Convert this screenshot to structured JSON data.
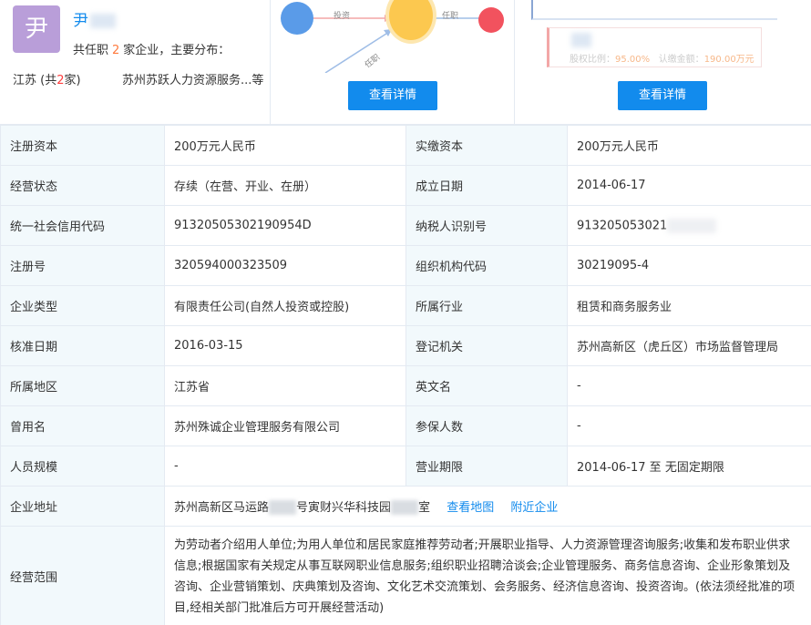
{
  "person": {
    "avatar_char": "尹",
    "name": "尹",
    "summary_prefix": "共任职",
    "company_count": "2",
    "summary_suffix": "家企业，主要分布：",
    "region_name": "江苏 (共",
    "region_count": "2",
    "region_suffix": "家)",
    "region_company": "苏州苏跃人力资源服务...等"
  },
  "graph": {
    "edge_invest": "投资",
    "edge_role": "任职",
    "edge_role2": "任职"
  },
  "share": {
    "ratio_label": "股权比例：",
    "ratio_value": "95.00%",
    "capital_label": "认缴金额：",
    "capital_value": "190.00万元"
  },
  "buttons": {
    "detail1": "查看详情",
    "detail2": "查看详情"
  },
  "rows": [
    {
      "l1": "注册资本",
      "v1": "200万元人民币",
      "l2": "实缴资本",
      "v2": "200万元人民币"
    },
    {
      "l1": "经营状态",
      "v1": "存续（在营、开业、在册）",
      "l2": "成立日期",
      "v2": "2014-06-17"
    },
    {
      "l1": "统一社会信用代码",
      "v1": "91320505302190954D",
      "l2": "纳税人识别号",
      "v2": "913205053021"
    },
    {
      "l1": "注册号",
      "v1": "320594000323509",
      "l2": "组织机构代码",
      "v2": "30219095-4"
    },
    {
      "l1": "企业类型",
      "v1": "有限责任公司(自然人投资或控股)",
      "l2": "所属行业",
      "v2": "租赁和商务服务业"
    },
    {
      "l1": "核准日期",
      "v1": "2016-03-15",
      "l2": "登记机关",
      "v2": "苏州高新区（虎丘区）市场监督管理局"
    },
    {
      "l1": "所属地区",
      "v1": "江苏省",
      "l2": "英文名",
      "v2": "-"
    },
    {
      "l1": "曾用名",
      "v1": "苏州殊诚企业管理服务有限公司",
      "l2": "参保人数",
      "v2": "-"
    },
    {
      "l1": "人员规模",
      "v1": "-",
      "l2": "营业期限",
      "v2": "2014-06-17 至 无固定期限"
    }
  ],
  "address": {
    "label": "企业地址",
    "part1": "苏州高新区马运路",
    "part2": "号寅财兴华科技园",
    "part3": "室",
    "map_link": "查看地图",
    "nearby_link": "附近企业"
  },
  "scope": {
    "label": "经营范围",
    "text": "为劳动者介绍用人单位;为用人单位和居民家庭推荐劳动者;开展职业指导、人力资源管理咨询服务;收集和发布职业供求信息;根据国家有关规定从事互联网职业信息服务;组织职业招聘洽谈会;企业管理服务、商务信息咨询、企业形象策划及咨询、企业营销策划、庆典策划及咨询、文化艺术交流策划、会务服务、经济信息咨询、投资咨询。(依法须经批准的项目,经相关部门批准后方可开展经营活动)"
  }
}
